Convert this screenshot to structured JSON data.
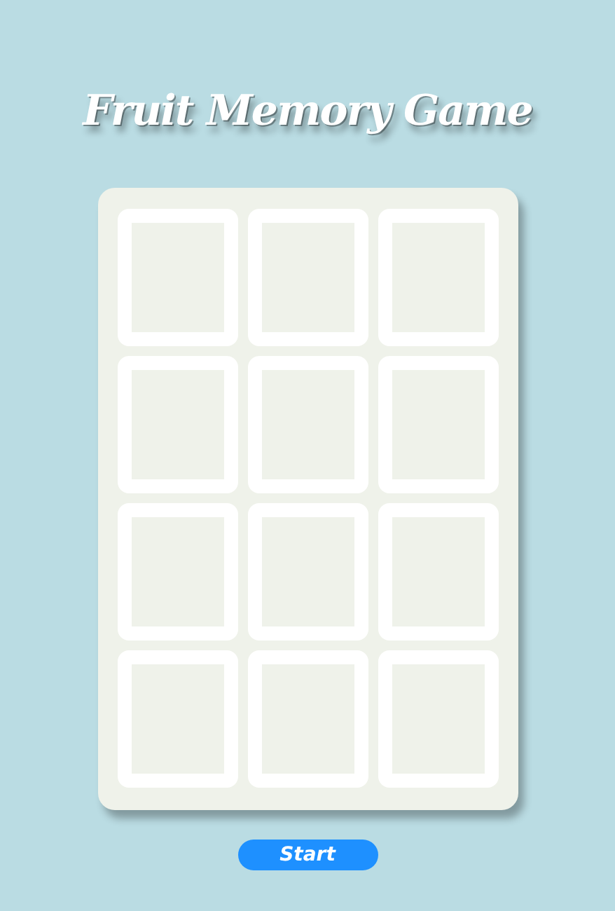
{
  "title": "Fruit Memory Game",
  "cards": [
    {
      "flipped": false
    },
    {
      "flipped": false
    },
    {
      "flipped": false
    },
    {
      "flipped": false
    },
    {
      "flipped": false
    },
    {
      "flipped": false
    },
    {
      "flipped": false
    },
    {
      "flipped": false
    },
    {
      "flipped": false
    },
    {
      "flipped": false
    },
    {
      "flipped": false
    },
    {
      "flipped": false
    }
  ],
  "start_button": "Start"
}
